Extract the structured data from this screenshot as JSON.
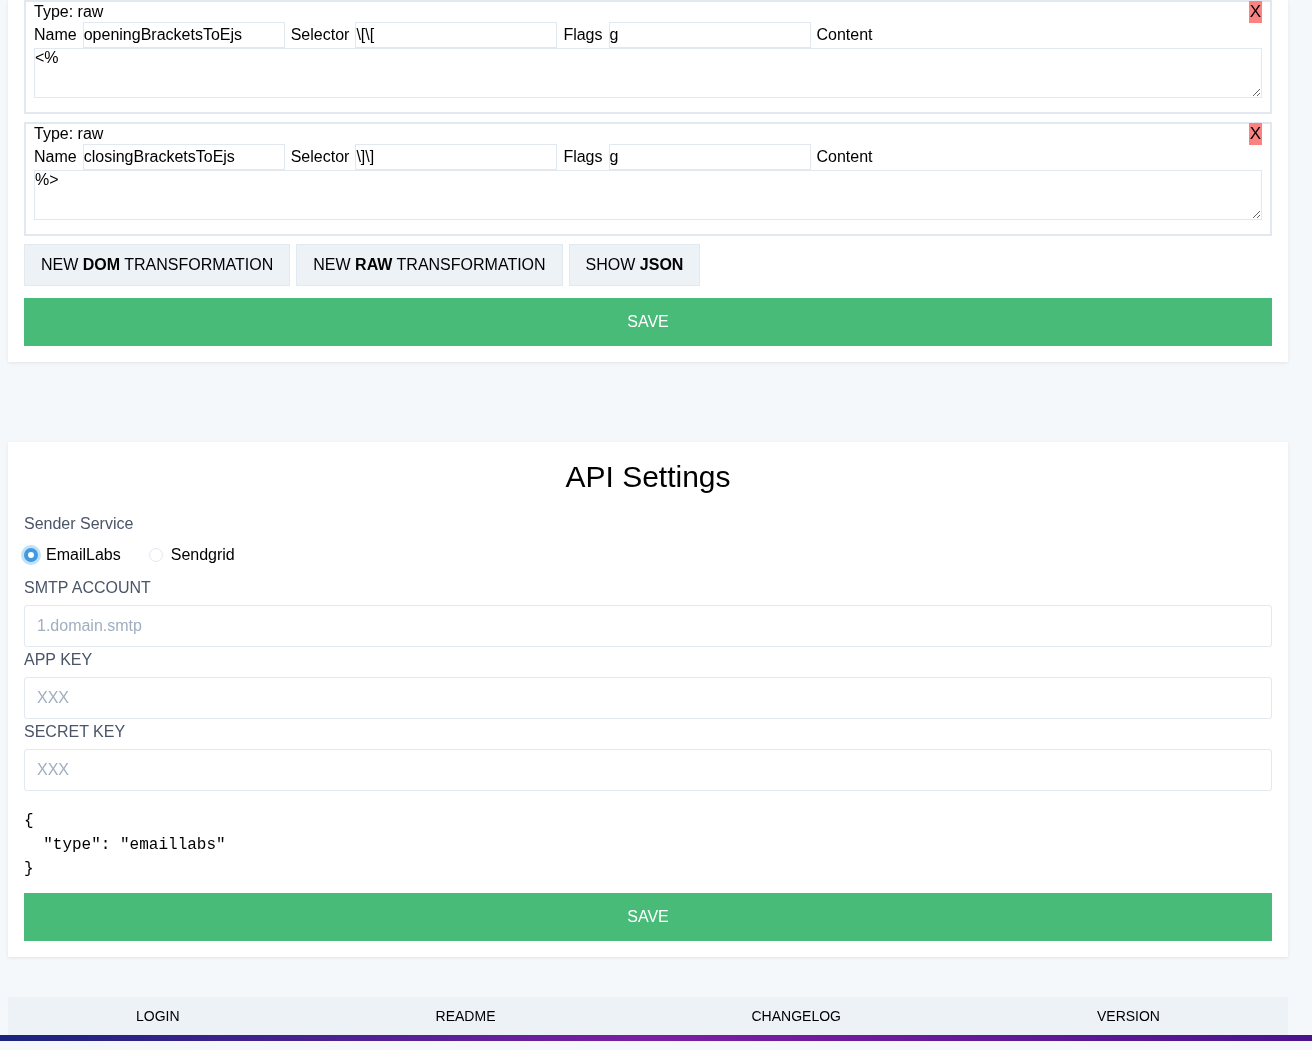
{
  "transformations": [
    {
      "type_label": "Type:",
      "type": "raw",
      "delete": "X",
      "name_label": "Name",
      "name": "openingBracketsToEjs",
      "selector_label": "Selector",
      "selector": "\\[\\[",
      "flags_label": "Flags",
      "flags": "g",
      "content_label": "Content",
      "content": "<%"
    },
    {
      "type_label": "Type:",
      "type": "raw",
      "delete": "X",
      "name_label": "Name",
      "name": "closingBracketsToEjs",
      "selector_label": "Selector",
      "selector": "\\]\\]",
      "flags_label": "Flags",
      "flags": "g",
      "content_label": "Content",
      "content": "%>"
    }
  ],
  "actions": [
    "NEW **DOM** TRANSFORMATION",
    "NEW **RAW** TRANSFORMATION",
    "SHOW **JSON**"
  ],
  "save_transformations": "SAVE",
  "api_settings": {
    "title": "API Settings",
    "sender_label": "Sender Service",
    "senders": [
      {
        "label": "EmailLabs",
        "selected": true
      },
      {
        "label": "Sendgrid",
        "selected": false
      }
    ],
    "fields": [
      {
        "label": "SMTP ACCOUNT",
        "placeholder": "1.domain.smtp"
      },
      {
        "label": "APP KEY",
        "placeholder": "XXX"
      },
      {
        "label": "SECRET KEY",
        "placeholder": "XXX"
      }
    ],
    "json_preview": "{\n  \"type\": \"emaillabs\"\n}",
    "save": "SAVE"
  },
  "footer": [
    "LOGIN",
    "README",
    "CHANGELOG",
    "VERSION"
  ]
}
